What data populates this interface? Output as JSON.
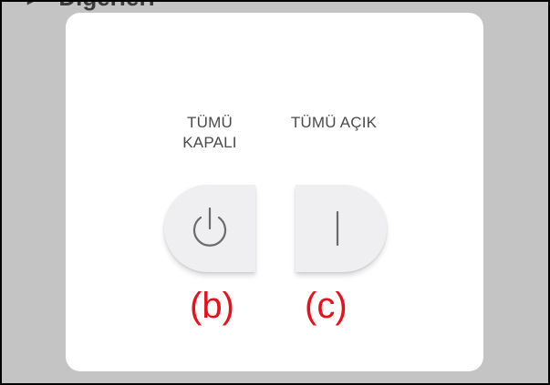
{
  "background": {
    "header_text": "Diğerleri"
  },
  "dialog": {
    "all_off_label_line1": "TÜMÜ",
    "all_off_label_line2": "KAPALI",
    "all_on_label": "TÜMÜ AÇIK"
  },
  "annotations": {
    "b": "(b)",
    "c": "(c)"
  },
  "colors": {
    "frame_border": "#000000",
    "backdrop": "#c4c4c4",
    "dialog": "#ffffff",
    "button": "#efeff1",
    "icon": "#6a6a6a",
    "annotation": "#e8101a"
  },
  "icons": {
    "off": "power-icon",
    "on": "on-line-icon",
    "header": "triangle-right-icon"
  }
}
